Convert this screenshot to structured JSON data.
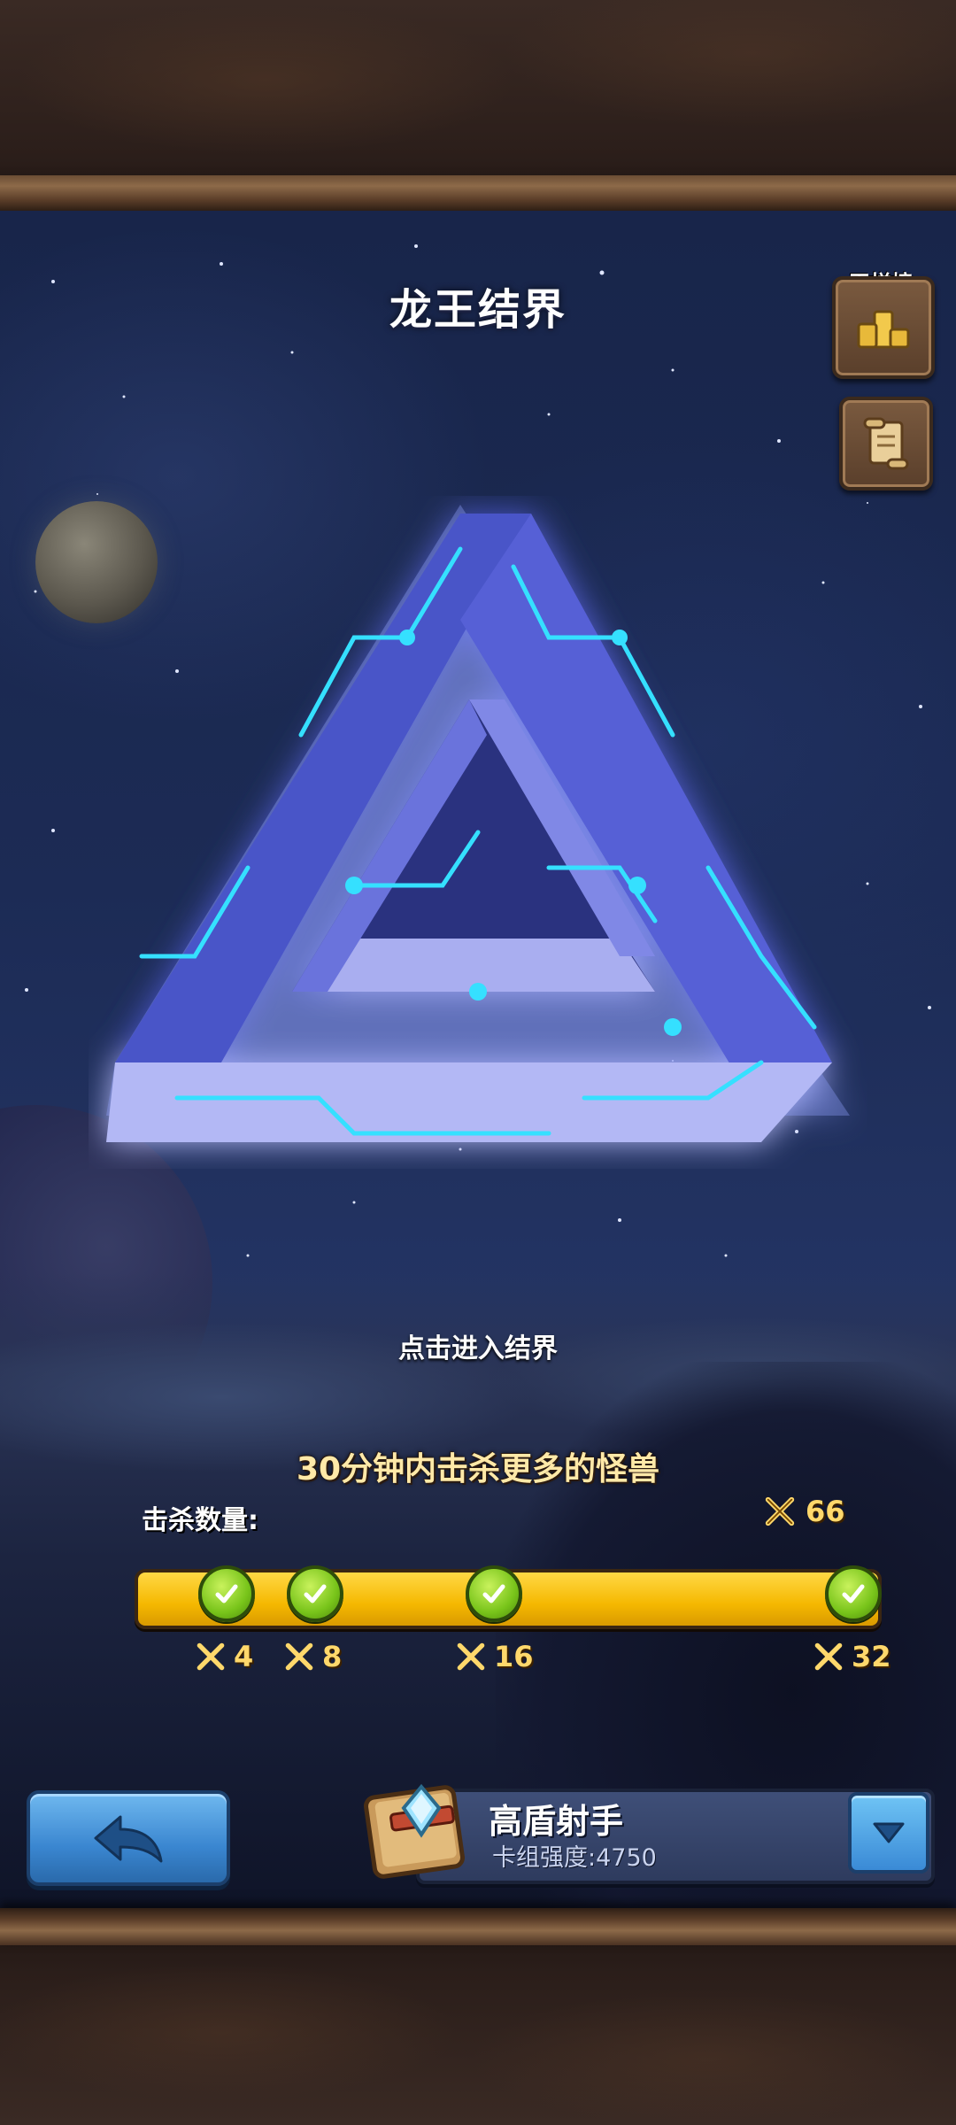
{
  "header": {
    "title": "龙王结界",
    "ladder_label": "天梯榜"
  },
  "realm": {
    "enter_hint": "点击进入结界"
  },
  "challenge": {
    "goal": "30分钟内击杀更多的怪兽",
    "kill_label": "击杀数量:",
    "kill_count": "66",
    "milestones": [
      {
        "value": "4",
        "done": true
      },
      {
        "value": "8",
        "done": true
      },
      {
        "value": "16",
        "done": true
      },
      {
        "value": "32",
        "done": true
      }
    ]
  },
  "deck": {
    "name": "高盾射手",
    "power": "卡组强度:4750"
  },
  "icons": {
    "ladder": "podium-icon",
    "scroll": "scroll-icon",
    "back": "back-arrow-icon",
    "dropdown": "chevron-down-icon",
    "kills": "crossed-swords-icon",
    "check": "check-icon",
    "deck": "deck-book-icon"
  }
}
